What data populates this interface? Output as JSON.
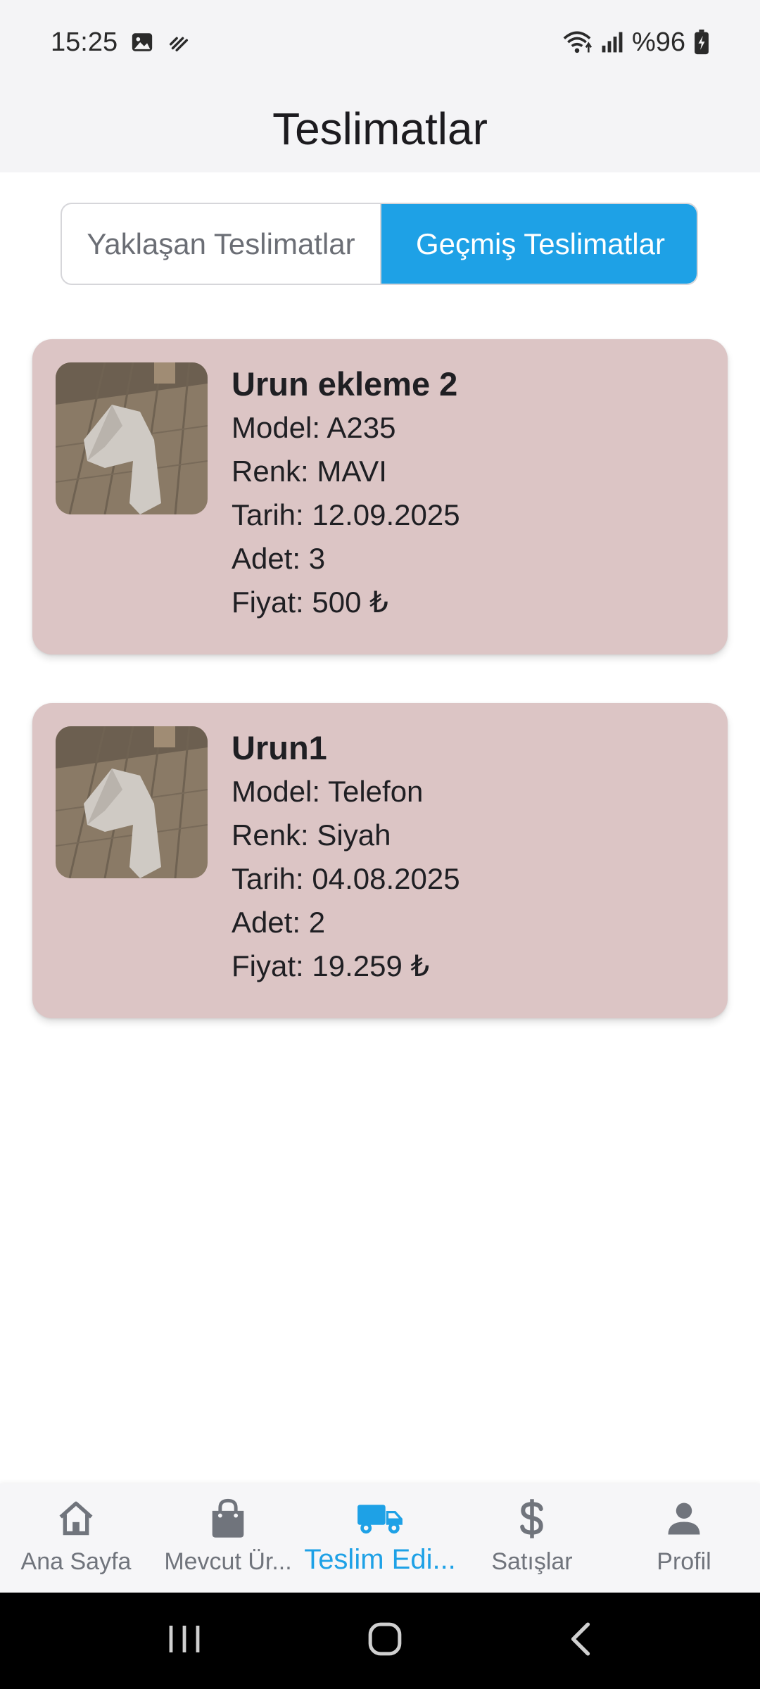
{
  "status_bar": {
    "time": "15:25",
    "battery": "%96"
  },
  "header": {
    "title": "Teslimatlar"
  },
  "tabs": [
    {
      "label": "Yaklaşan Teslimatlar",
      "active": false
    },
    {
      "label": "Geçmiş Teslimatlar",
      "active": true
    }
  ],
  "deliveries": [
    {
      "name": "Urun ekleme 2",
      "model": "Model: A235",
      "color": "Renk: MAVI",
      "date": "Tarih: 12.09.2025",
      "qty": "Adet: 3",
      "price": "Fiyat: 500 ₺"
    },
    {
      "name": "Urun1",
      "model": "Model: Telefon",
      "color": "Renk: Siyah",
      "date": "Tarih: 04.08.2025",
      "qty": "Adet: 2",
      "price": "Fiyat: 19.259 ₺"
    }
  ],
  "bottom_nav": [
    {
      "label": "Ana Sayfa",
      "icon": "home-icon"
    },
    {
      "label": "Mevcut Ür...",
      "icon": "shopping-bag-icon"
    },
    {
      "label": "Teslim Edi...",
      "icon": "truck-icon",
      "active": true
    },
    {
      "label": "Satışlar",
      "icon": "dollar-icon"
    },
    {
      "label": "Profil",
      "icon": "person-icon"
    }
  ],
  "colors": {
    "accent": "#1ea1e6",
    "card_bg": "#dcc5c5",
    "header_bg": "#f4f4f6"
  }
}
